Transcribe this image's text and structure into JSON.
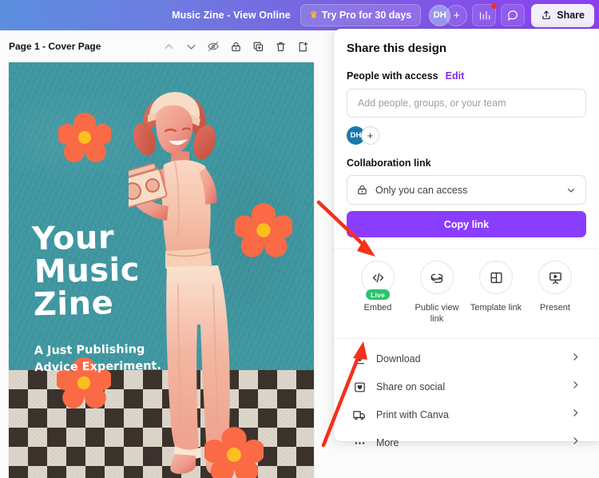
{
  "header": {
    "doc_title": "Music Zine - View Online",
    "try_pro_label": "Try Pro for 30 days",
    "crown_icon": "crown-icon",
    "avatar_initials": "DH",
    "avatar_add_label": "+",
    "insights_icon": "bar-chart-icon",
    "comments_icon": "comment-bubble-icon",
    "share_label": "Share",
    "share_icon": "share-upload-icon",
    "gradient_start": "#5b8ede",
    "gradient_end": "#8b3ff2"
  },
  "page_toolbar": {
    "page_label": "Page 1 - Cover Page",
    "icons": [
      {
        "name": "chevron-up-icon",
        "title": "Move page up"
      },
      {
        "name": "chevron-down-icon",
        "title": "Move page down"
      },
      {
        "name": "hide-page-icon",
        "title": "Hide page"
      },
      {
        "name": "lock-icon",
        "title": "Lock page"
      },
      {
        "name": "duplicate-page-icon",
        "title": "Duplicate page"
      },
      {
        "name": "trash-icon",
        "title": "Delete page"
      },
      {
        "name": "add-page-icon",
        "title": "Add page"
      }
    ]
  },
  "artwork": {
    "title_line1": "Your",
    "title_line2": "Music",
    "title_line3": "Zine",
    "subtitle_line1": "A Just Publishing",
    "subtitle_line2": "Advice Experiment.",
    "background_color": "#3f97a1",
    "accent_color": "#fa6a45",
    "flower_center_color": "#fcbf1e",
    "checker_dark": "#3c332c",
    "checker_light": "#ddd7cb"
  },
  "share_panel": {
    "title": "Share this design",
    "people_section_label": "People with access",
    "edit_link": "Edit",
    "people_input_placeholder": "Add people, groups, or your team",
    "avatar_initials": "DH",
    "avatar_add_label": "+",
    "collaboration_label": "Collaboration link",
    "access_value": "Only you can access",
    "access_icon": "lock-icon",
    "caret_icon": "chevron-down-icon",
    "copy_link_label": "Copy link",
    "copy_link_color": "#8b3dff",
    "quick_actions": [
      {
        "label": "Embed",
        "icon": "code-brackets-icon",
        "badge": "Live",
        "badge_color": "#2bc46a"
      },
      {
        "label": "Public view link",
        "icon": "link-chain-icon",
        "badge": ""
      },
      {
        "label": "Template link",
        "icon": "template-panels-icon",
        "badge": ""
      },
      {
        "label": "Present",
        "icon": "presentation-screen-icon",
        "badge": ""
      }
    ],
    "menu_items": [
      {
        "label": "Download",
        "icon": "download-icon"
      },
      {
        "label": "Share on social",
        "icon": "social-heart-icon"
      },
      {
        "label": "Print with Canva",
        "icon": "delivery-truck-icon"
      },
      {
        "label": "More",
        "icon": "ellipsis-icon"
      }
    ]
  },
  "annotations": {
    "color": "#f5301b",
    "arrows": [
      {
        "name": "arrow-to-embed",
        "target": "Embed"
      },
      {
        "name": "arrow-to-download",
        "target": "Download"
      }
    ]
  }
}
